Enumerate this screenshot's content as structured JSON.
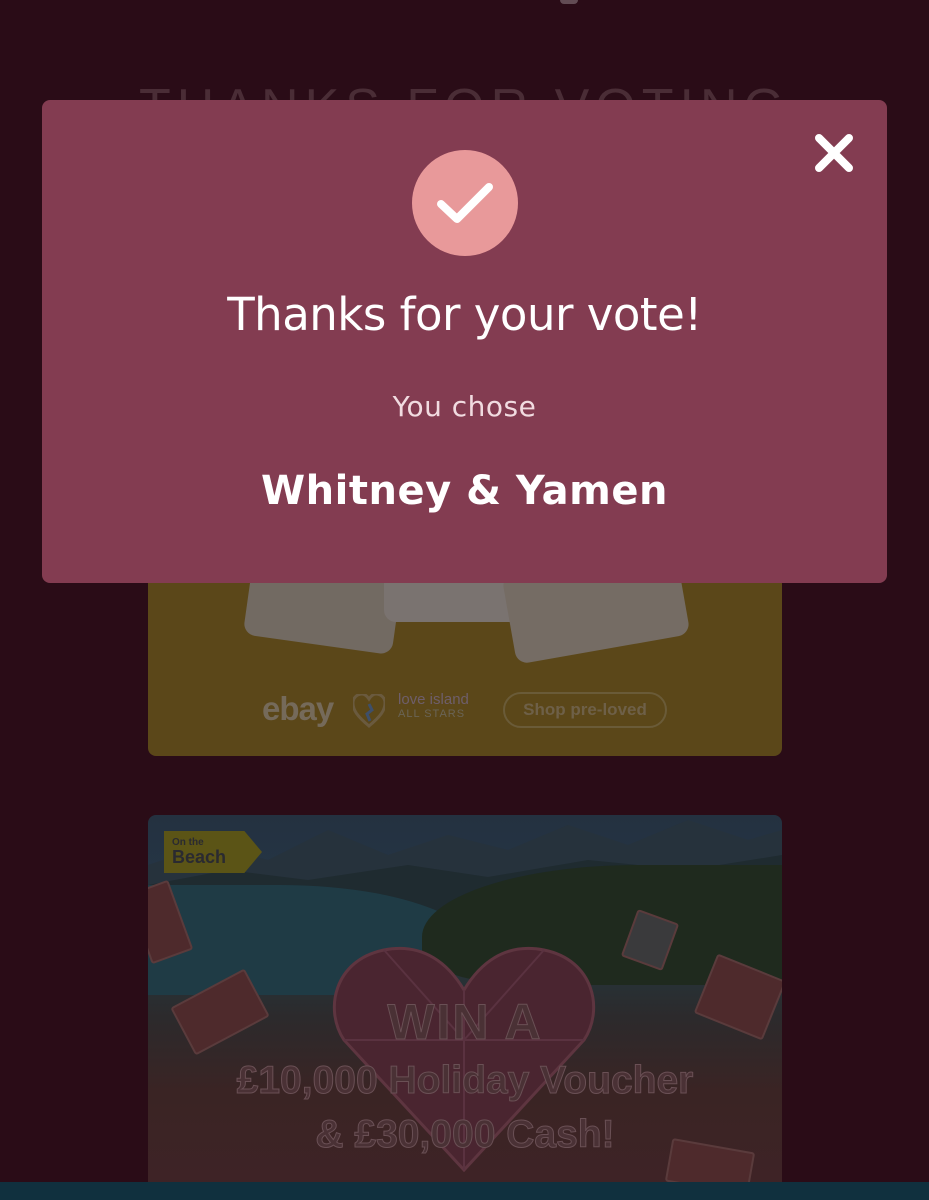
{
  "background": {
    "page_heading": "THANKS FOR VOTING",
    "ebay_banner": {
      "brand": "ebay",
      "partner_title": "love island",
      "partner_subtitle": "ALL STARS",
      "cta_label": "Shop pre-loved"
    },
    "beach_banner": {
      "badge_small": "On the",
      "badge_big": "Beach",
      "line1": "WIN A",
      "line2": "£10,000 Holiday Voucher",
      "line3": "& £30,000 Cash!"
    }
  },
  "modal": {
    "title": "Thanks for your vote!",
    "subtitle": "You chose",
    "choice": "Whitney & Yamen",
    "close_icon": "close-icon",
    "check_icon": "checkmark-icon",
    "colors": {
      "modal_bg": "#833c51",
      "check_circle": "#e8999a",
      "page_bg": "#2a0c17"
    }
  }
}
